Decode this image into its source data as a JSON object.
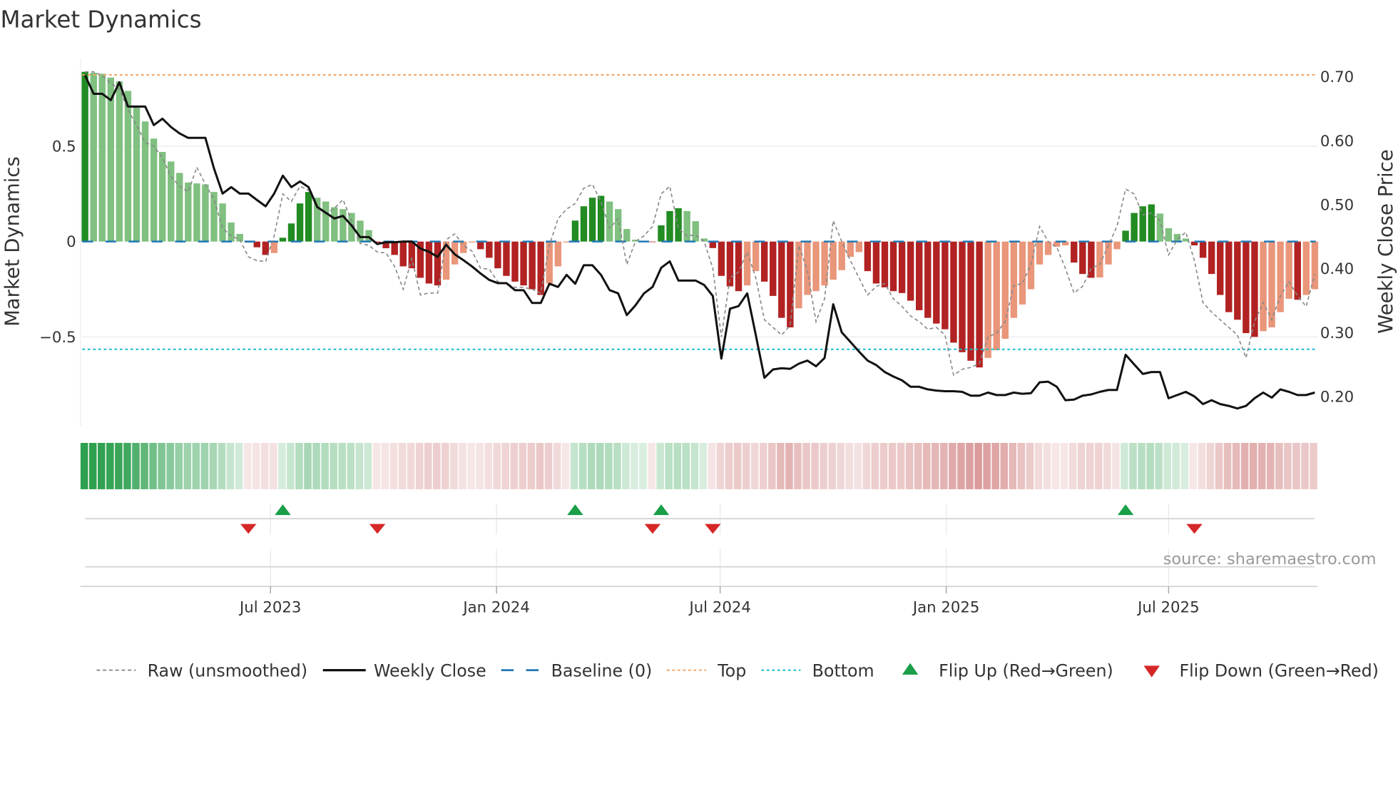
{
  "title": "Market Dynamics",
  "source": "source: sharemaestro.com",
  "legend": {
    "raw": "Raw (unsmoothed)",
    "close": "Weekly Close",
    "baseline": "Baseline (0)",
    "top": "Top",
    "bottom": "Bottom",
    "flip_up": "Flip Up (Red→Green)",
    "flip_down": "Flip Down (Green→Red)"
  },
  "chart_data": {
    "type": "bar",
    "title": "Market Dynamics",
    "ylabel_left": "Market Dynamics",
    "ylabel_right": "Weekly Close Price",
    "left_ylim": [
      -0.967,
      0.963
    ],
    "right_ylim": [
      0.1527,
      0.728
    ],
    "left_ticks": [
      {
        "value": 0.5,
        "label": "0.5"
      },
      {
        "value": 0,
        "label": "0"
      },
      {
        "value": -0.5,
        "label": "−0.5"
      }
    ],
    "right_ticks": [
      {
        "value": 0.7,
        "label": "0.70"
      },
      {
        "value": 0.6,
        "label": "0.60"
      },
      {
        "value": 0.5,
        "label": "0.50"
      },
      {
        "value": 0.4,
        "label": "0.40"
      },
      {
        "value": 0.3,
        "label": "0.30"
      },
      {
        "value": 0.2,
        "label": "0.20"
      }
    ],
    "x_start": "2023-01-31",
    "x_step_days": 7,
    "x_ticks": [
      {
        "date": "2023-07-01",
        "label": "Jul 2023"
      },
      {
        "date": "2024-01-01",
        "label": "Jan 2024"
      },
      {
        "date": "2024-07-01",
        "label": "Jul 2024"
      },
      {
        "date": "2025-01-01",
        "label": "Jan 2025"
      },
      {
        "date": "2025-07-01",
        "label": "Jul 2025"
      }
    ],
    "grid": true,
    "legend_position": "bottom",
    "top_level": 0.874,
    "bottom_level": -0.565,
    "baseline": 0,
    "dynamics": [
      0.89,
      0.885,
      0.88,
      0.86,
      0.84,
      0.79,
      0.71,
      0.63,
      0.54,
      0.47,
      0.42,
      0.36,
      0.31,
      0.305,
      0.3,
      0.26,
      0.2,
      0.1,
      0.04,
      -0.005,
      -0.03,
      -0.07,
      -0.06,
      0.02,
      0.095,
      0.2,
      0.26,
      0.23,
      0.21,
      0.18,
      0.17,
      0.15,
      0.11,
      0.06,
      -0.005,
      -0.035,
      -0.07,
      -0.13,
      -0.14,
      -0.19,
      -0.22,
      -0.23,
      -0.2,
      -0.12,
      -0.06,
      -0.005,
      -0.04,
      -0.085,
      -0.14,
      -0.18,
      -0.21,
      -0.23,
      -0.25,
      -0.28,
      -0.22,
      -0.13,
      -0.005,
      0.11,
      0.185,
      0.23,
      0.24,
      0.21,
      0.17,
      0.066,
      0.01,
      0.003,
      -0.003,
      0.085,
      0.16,
      0.175,
      0.16,
      0.107,
      0.016,
      -0.034,
      -0.18,
      -0.235,
      -0.26,
      -0.23,
      -0.155,
      -0.21,
      -0.285,
      -0.4,
      -0.45,
      -0.35,
      -0.28,
      -0.26,
      -0.23,
      -0.2,
      -0.15,
      -0.08,
      -0.055,
      -0.155,
      -0.22,
      -0.24,
      -0.26,
      -0.27,
      -0.31,
      -0.36,
      -0.4,
      -0.43,
      -0.46,
      -0.53,
      -0.58,
      -0.625,
      -0.66,
      -0.61,
      -0.57,
      -0.51,
      -0.4,
      -0.33,
      -0.25,
      -0.12,
      -0.07,
      -0.027,
      -0.02,
      -0.11,
      -0.17,
      -0.19,
      -0.188,
      -0.12,
      -0.04,
      0.057,
      0.15,
      0.185,
      0.195,
      0.147,
      0.07,
      0.04,
      0.016,
      -0.02,
      -0.085,
      -0.17,
      -0.28,
      -0.37,
      -0.41,
      -0.48,
      -0.5,
      -0.47,
      -0.45,
      -0.37,
      -0.3,
      -0.305,
      -0.28,
      -0.25
    ],
    "raw": [
      0.89,
      0.89,
      0.87,
      0.83,
      0.8,
      0.69,
      0.61,
      0.52,
      0.5,
      0.44,
      0.34,
      0.29,
      0.26,
      0.39,
      0.3,
      0.22,
      0.07,
      0.03,
      0.01,
      -0.08,
      -0.1,
      -0.105,
      0.03,
      0.25,
      0.21,
      0.29,
      0.27,
      0.18,
      0.145,
      0.175,
      0.22,
      0.11,
      -0.01,
      -0.02,
      -0.055,
      -0.06,
      -0.13,
      -0.25,
      -0.09,
      -0.28,
      -0.27,
      -0.27,
      0.01,
      0.04,
      -0.02,
      -0.05,
      -0.14,
      -0.145,
      -0.21,
      -0.22,
      -0.24,
      -0.24,
      -0.25,
      -0.27,
      -0.02,
      0.12,
      0.17,
      0.2,
      0.28,
      0.3,
      0.21,
      0.07,
      0.12,
      -0.12,
      0.0,
      0.03,
      0.08,
      0.25,
      0.29,
      0.07,
      0.03,
      0.035,
      0.0,
      -0.14,
      -0.5,
      -0.19,
      -0.16,
      -0.055,
      -0.19,
      -0.41,
      -0.45,
      -0.49,
      -0.44,
      -0.02,
      -0.15,
      -0.42,
      -0.3,
      0.11,
      0.0,
      -0.1,
      -0.19,
      -0.28,
      -0.235,
      -0.22,
      -0.3,
      -0.34,
      -0.39,
      -0.42,
      -0.46,
      -0.45,
      -0.49,
      -0.7,
      -0.67,
      -0.66,
      -0.64,
      -0.5,
      -0.48,
      -0.42,
      -0.23,
      -0.22,
      -0.12,
      0.08,
      0.0,
      -0.03,
      -0.14,
      -0.27,
      -0.235,
      -0.14,
      -0.12,
      -0.02,
      0.08,
      0.275,
      0.25,
      0.14,
      0.15,
      0.11,
      -0.07,
      0.01,
      0.05,
      -0.1,
      -0.32,
      -0.37,
      -0.41,
      -0.45,
      -0.49,
      -0.61,
      -0.42,
      -0.32,
      -0.41,
      -0.285,
      -0.21,
      -0.285,
      -0.34,
      -0.17
    ],
    "close": [
      0.701,
      0.672,
      0.672,
      0.662,
      0.69,
      0.652,
      0.652,
      0.652,
      0.623,
      0.633,
      0.62,
      0.61,
      0.603,
      0.603,
      0.603,
      0.555,
      0.516,
      0.526,
      0.516,
      0.516,
      0.506,
      0.496,
      0.516,
      0.544,
      0.526,
      0.535,
      0.526,
      0.495,
      0.486,
      0.477,
      0.481,
      0.466,
      0.448,
      0.448,
      0.437,
      0.44,
      0.44,
      0.441,
      0.441,
      0.43,
      0.425,
      0.417,
      0.436,
      0.421,
      0.412,
      0.402,
      0.391,
      0.381,
      0.376,
      0.376,
      0.365,
      0.365,
      0.345,
      0.345,
      0.375,
      0.37,
      0.389,
      0.375,
      0.404,
      0.404,
      0.389,
      0.365,
      0.36,
      0.326,
      0.341,
      0.36,
      0.37,
      0.4,
      0.41,
      0.38,
      0.38,
      0.38,
      0.373,
      0.356,
      0.258,
      0.336,
      0.34,
      0.36,
      0.295,
      0.228,
      0.241,
      0.243,
      0.242,
      0.25,
      0.255,
      0.246,
      0.259,
      0.343,
      0.299,
      0.284,
      0.269,
      0.255,
      0.248,
      0.237,
      0.23,
      0.224,
      0.214,
      0.214,
      0.21,
      0.208,
      0.207,
      0.207,
      0.206,
      0.2,
      0.2,
      0.205,
      0.201,
      0.201,
      0.205,
      0.203,
      0.204,
      0.221,
      0.222,
      0.214,
      0.193,
      0.194,
      0.2,
      0.202,
      0.206,
      0.209,
      0.209,
      0.264,
      0.249,
      0.234,
      0.237,
      0.237,
      0.196,
      0.201,
      0.206,
      0.199,
      0.187,
      0.193,
      0.187,
      0.184,
      0.18,
      0.184,
      0.196,
      0.205,
      0.197,
      0.21,
      0.206,
      0.201,
      0.201,
      0.205
    ],
    "flips_up": [
      23,
      57,
      67,
      121
    ],
    "flips_down": [
      19,
      34,
      66,
      73,
      129
    ],
    "colors": {
      "pos_strong": "#228b22",
      "pos_weak": "#80c080",
      "neg_strong": "#b22222",
      "neg_weak": "#e9967a",
      "close": "#111111",
      "raw": "#888888",
      "baseline": "#1f77b4",
      "top": "#f4a261",
      "bottom": "#17becf",
      "flip_up": "#1a9e48",
      "flip_down": "#d62728",
      "strip_pos": "#2ea04f",
      "strip_neg": "#c96a6a"
    }
  }
}
